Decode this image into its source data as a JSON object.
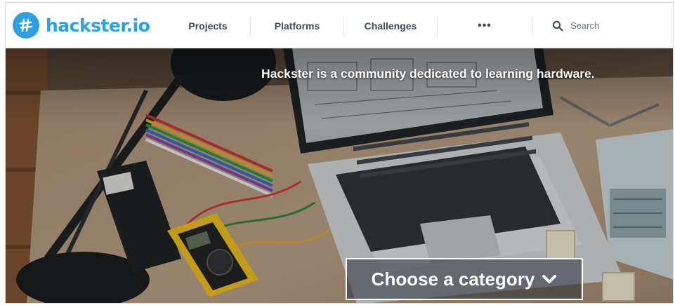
{
  "brand": {
    "name": "hackster.io",
    "color": "#2e9fe0",
    "icon": "hackster-logo-icon"
  },
  "nav": {
    "items": [
      {
        "label": "Projects"
      },
      {
        "label": "Platforms"
      },
      {
        "label": "Challenges"
      },
      {
        "label": "•••",
        "icon": "more-dots-icon"
      }
    ]
  },
  "search": {
    "placeholder": "Search",
    "icon": "search-icon"
  },
  "hero": {
    "tagline": "Hackster is a community dedicated to learning hardware.",
    "cta_label": "Choose a category",
    "cta_icon": "chevron-down-icon"
  }
}
